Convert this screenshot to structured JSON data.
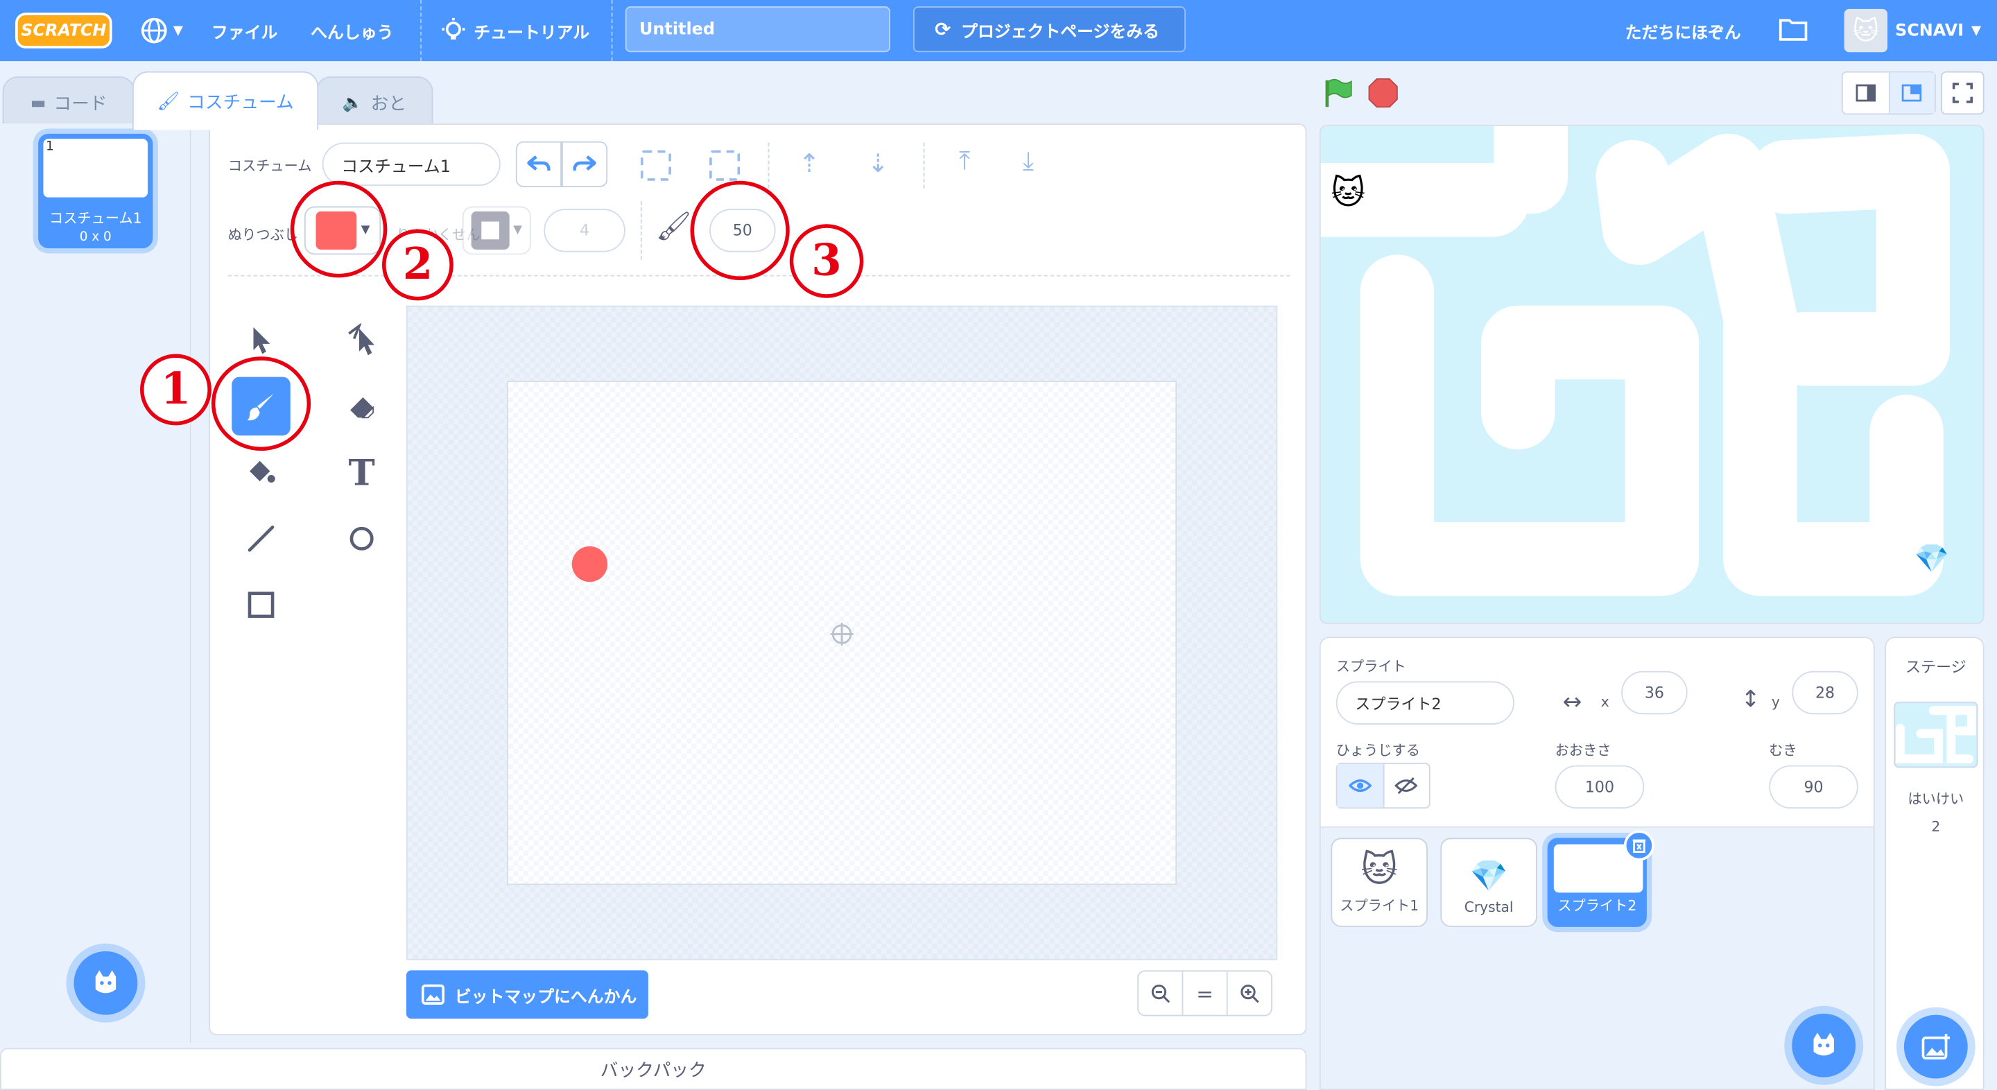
{
  "menubar": {
    "logo": "SCRATCH",
    "items": [
      "ファイル",
      "へんしゅう"
    ],
    "tutorial": "チュートリアル",
    "project_title": "Untitled",
    "project_page": "プロジェクトページをみる",
    "save_now": "ただちにほぞん",
    "username": "SCNAVI"
  },
  "tabs": {
    "code": "コード",
    "costume": "コスチューム",
    "sound": "おと"
  },
  "costume_list": {
    "items": [
      {
        "number": "1",
        "name": "コスチューム1",
        "size": "0 x 0"
      }
    ]
  },
  "editor": {
    "costume_label": "コスチューム",
    "costume_name": "コスチューム1",
    "fill_label": "ぬりつぶし",
    "fill_color": "#ff6666",
    "outline_label": "りんかくせん",
    "outline_width": "4",
    "brush_size": "50",
    "convert_button": "ビットマップにへんかん"
  },
  "annotations": {
    "one": "1",
    "two": "2",
    "three": "3"
  },
  "sprite_info": {
    "sprite_label": "スプライト",
    "sprite_name": "スプライト2",
    "x_label": "x",
    "x_value": "36",
    "y_label": "y",
    "y_value": "28",
    "show_label": "ひょうじする",
    "size_label": "おおきさ",
    "size_value": "100",
    "direction_label": "むき",
    "direction_value": "90"
  },
  "sprites": [
    {
      "name": "スプライト1",
      "icon": "cat-icon"
    },
    {
      "name": "Crystal",
      "icon": "crystal-icon"
    },
    {
      "name": "スプライト2",
      "icon": "blank-icon"
    }
  ],
  "stage_panel": {
    "title": "ステージ",
    "backdrops_label": "はいけい",
    "backdrops_count": "2"
  },
  "backpack": "バックパック",
  "colors": {
    "accent": "#4c97ff",
    "annotation_red": "#e60012",
    "stage_bg": "#d2f2fc"
  }
}
